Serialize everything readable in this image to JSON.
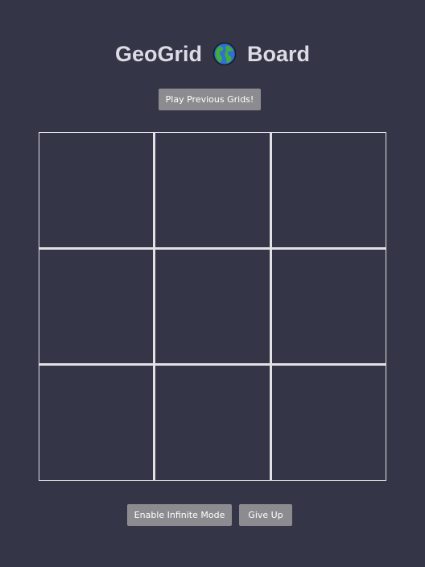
{
  "header": {
    "title_left": "GeoGrid",
    "title_right": "Board",
    "title_icon": "globe-icon"
  },
  "controls": {
    "previous_grids_label": "Play Previous Grids!",
    "infinite_mode_label": "Enable Infinite Mode",
    "give_up_label": "Give Up"
  },
  "grid": {
    "rows": 3,
    "columns": 3,
    "cells": [
      "",
      "",
      "",
      "",
      "",
      "",
      "",
      "",
      ""
    ]
  },
  "colors": {
    "background": "#353548",
    "grid_lines": "#e2e2e6",
    "button": "#8c8c90",
    "title_text": "#dcdce4"
  }
}
